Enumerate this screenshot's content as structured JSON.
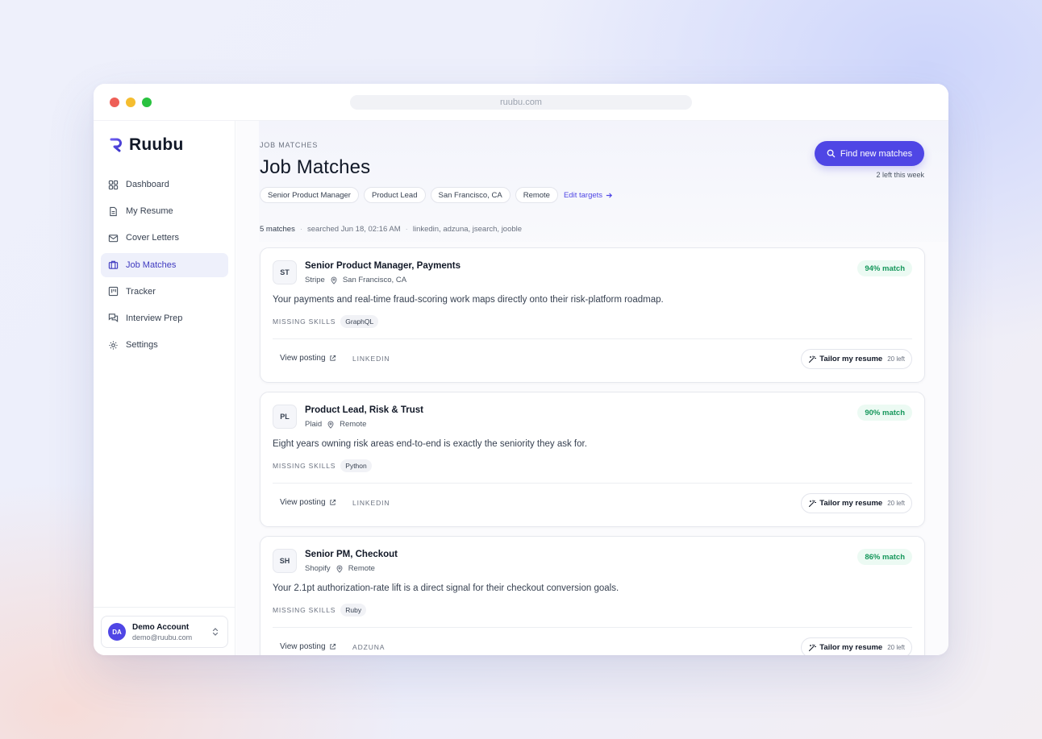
{
  "browser": {
    "url": "ruubu.com"
  },
  "brand": {
    "name": "Ruubu",
    "accent": "#4f46e5"
  },
  "sidebar": {
    "items": [
      {
        "label": "Dashboard",
        "icon": "grid-icon"
      },
      {
        "label": "My Resume",
        "icon": "document-icon"
      },
      {
        "label": "Cover Letters",
        "icon": "mail-icon"
      },
      {
        "label": "Job Matches",
        "icon": "briefcase-icon",
        "active": true
      },
      {
        "label": "Tracker",
        "icon": "kanban-icon"
      },
      {
        "label": "Interview Prep",
        "icon": "chat-icon"
      },
      {
        "label": "Settings",
        "icon": "gear-icon"
      }
    ]
  },
  "account": {
    "initials": "DA",
    "name": "Demo Account",
    "email": "demo@ruubu.com"
  },
  "header": {
    "eyebrow": "JOB MATCHES",
    "title": "Job Matches",
    "find_button": "Find new matches",
    "quota": "2 left this week",
    "targets": [
      "Senior Product Manager",
      "Product Lead",
      "San Francisco, CA",
      "Remote"
    ],
    "edit_targets": "Edit targets"
  },
  "meta": {
    "count": "5 matches",
    "searched": "searched Jun 18, 02:16 AM",
    "sources": "linkedin, adzuna, jsearch, jooble"
  },
  "labels": {
    "missing_skills": "MISSING SKILLS",
    "view_posting": "View posting",
    "tailor": "Tailor my resume",
    "tailor_left": "20 left"
  },
  "jobs": [
    {
      "initials": "ST",
      "title": "Senior Product Manager, Payments",
      "company": "Stripe",
      "location": "San Francisco, CA",
      "match": "94% match",
      "summary": "Your payments and real-time fraud-scoring work maps directly onto their risk-platform roadmap.",
      "missing_skill": "GraphQL",
      "source": "LINKEDIN"
    },
    {
      "initials": "PL",
      "title": "Product Lead, Risk & Trust",
      "company": "Plaid",
      "location": "Remote",
      "match": "90% match",
      "summary": "Eight years owning risk areas end-to-end is exactly the seniority they ask for.",
      "missing_skill": "Python",
      "source": "LINKEDIN"
    },
    {
      "initials": "SH",
      "title": "Senior PM, Checkout",
      "company": "Shopify",
      "location": "Remote",
      "match": "86% match",
      "summary": "Your 2.1pt authorization-rate lift is a direct signal for their checkout conversion goals.",
      "missing_skill": "Ruby",
      "source": "ADZUNA"
    }
  ]
}
